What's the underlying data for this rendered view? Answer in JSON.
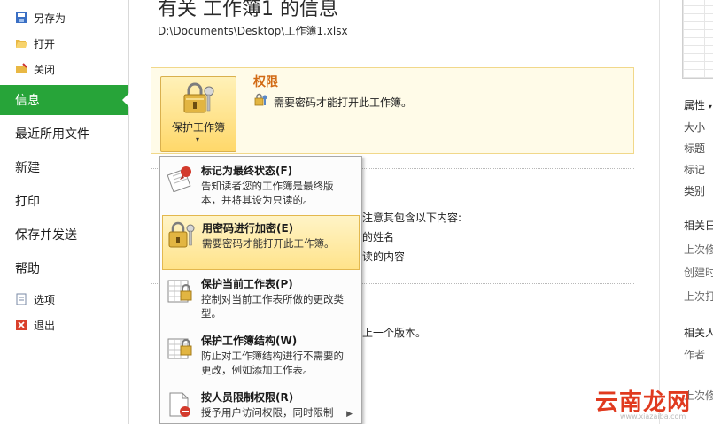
{
  "nav": {
    "save_as": "另存为",
    "open": "打开",
    "close": "关闭",
    "info": "信息",
    "recent": "最近所用文件",
    "new": "新建",
    "print": "打印",
    "save_send": "保存并发送",
    "help": "帮助",
    "options": "选项",
    "exit": "退出"
  },
  "main": {
    "title": "有关 工作簿1 的信息",
    "path": "D:\\Documents\\Desktop\\工作簿1.xlsx",
    "permissions": {
      "button_label": "保护工作簿",
      "heading": "权限",
      "description": "需要密码才能打开此工作簿。"
    },
    "background": {
      "line1": "注意其包含以下内容:",
      "line2": "的姓名",
      "line3": "读的内容",
      "line4": "上一个版本。"
    }
  },
  "menu": {
    "items": [
      {
        "title": "标记为最终状态(F)",
        "desc": "告知读者您的工作簿是最终版本，并将其设为只读的。"
      },
      {
        "title": "用密码进行加密(E)",
        "desc": "需要密码才能打开此工作簿。"
      },
      {
        "title": "保护当前工作表(P)",
        "desc": "控制对当前工作表所做的更改类型。"
      },
      {
        "title": "保护工作簿结构(W)",
        "desc": "防止对工作簿结构进行不需要的更改，例如添加工作表。"
      },
      {
        "title": "按人员限制权限(R)",
        "desc": "授予用户访问权限，同时限制"
      }
    ]
  },
  "right_panel": {
    "properties": "属性",
    "size": "大小",
    "title": "标题",
    "tags": "标记",
    "category": "类别",
    "related_dates": "相关日",
    "last_modified": "上次修",
    "created": "创建时",
    "last_printed": "上次打",
    "related_people": "相关人",
    "author": "作者",
    "last_modified_by": "上次修"
  },
  "watermark": {
    "text": "云南龙网",
    "sub": "www.xiazaiba.com"
  },
  "colors": {
    "accent_green": "#27a439",
    "heading_orange": "#d26a14",
    "highlight_yellow": "#ffe38a",
    "watermark_red": "#e03a1f"
  }
}
